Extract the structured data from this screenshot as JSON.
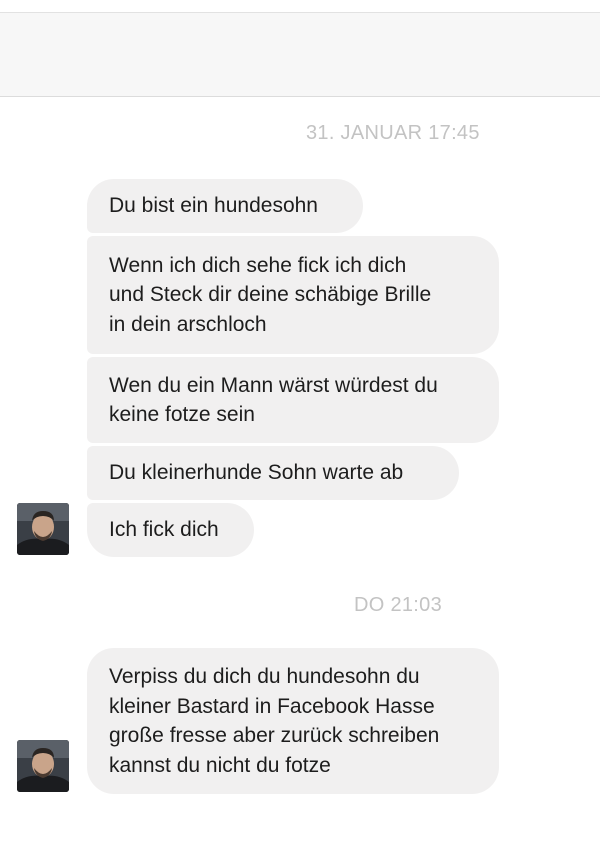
{
  "conversation": {
    "groups": [
      {
        "timestamp": "31. JANUAR 17:45",
        "messages": [
          "Du bist ein hundesohn",
          "Wenn ich dich sehe fick ich dich\nund Steck dir deine schäbige Brille\nin dein arschloch",
          "Wen du ein Mann wärst würdest du\nkeine fotze sein",
          "Du kleinerhunde Sohn warte ab",
          "Ich fick dich"
        ]
      },
      {
        "timestamp": "DO 21:03",
        "messages": [
          "Verpiss du dich du hundesohn du\nkleiner Bastard in Facebook Hasse\ngroße fresse aber zurück schreiben\nkannst du nicht du fotze"
        ]
      }
    ]
  },
  "colors": {
    "bubble_background": "#f1f0f0",
    "timestamp_text": "#c3c3c3",
    "header_background": "#f7f7f7"
  }
}
